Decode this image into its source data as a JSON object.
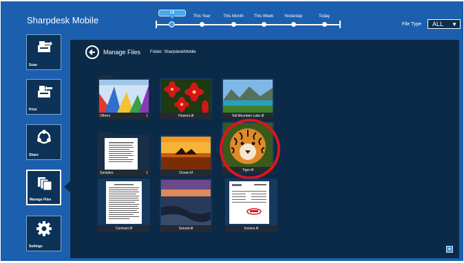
{
  "app": {
    "title": "Sharpdesk Mobile"
  },
  "timeline": {
    "labels": [
      "All",
      "This Year",
      "This Month",
      "This Week",
      "Yesterday",
      "Today"
    ],
    "selected": "All"
  },
  "file_type": {
    "label": "File Type",
    "value": "ALL"
  },
  "sidebar": {
    "items": [
      {
        "label": "Scan",
        "icon": "scan-icon"
      },
      {
        "label": "Print",
        "icon": "print-icon"
      },
      {
        "label": "Share",
        "icon": "share-icon"
      },
      {
        "label": "Manage Files",
        "icon": "manage-files-icon"
      },
      {
        "label": "Settings",
        "icon": "gear-icon"
      }
    ],
    "active": "Manage Files"
  },
  "main": {
    "title": "Manage Files",
    "folder": "Folder: SharpdeskMobile",
    "items": [
      {
        "name": "Others",
        "count": "1",
        "kind": "folder"
      },
      {
        "name": "Flowers.tif",
        "kind": "file"
      },
      {
        "name": "Tall Mountain Lake.tif",
        "kind": "file"
      },
      {
        "name": "Samples",
        "count": "1",
        "kind": "folder"
      },
      {
        "name": "Ocean.tif",
        "kind": "file"
      },
      {
        "name": "Tiger.tif",
        "kind": "file",
        "highlighted": true
      },
      {
        "name": "Contract.tif",
        "kind": "file"
      },
      {
        "name": "Sunset.tif",
        "kind": "file"
      },
      {
        "name": "Invoice.tif",
        "kind": "file"
      }
    ]
  },
  "colors": {
    "app_background": "#1b5fae",
    "panel_background": "#0b2a48",
    "highlight_ring": "#e0141c",
    "accent": "#49a6ea"
  }
}
